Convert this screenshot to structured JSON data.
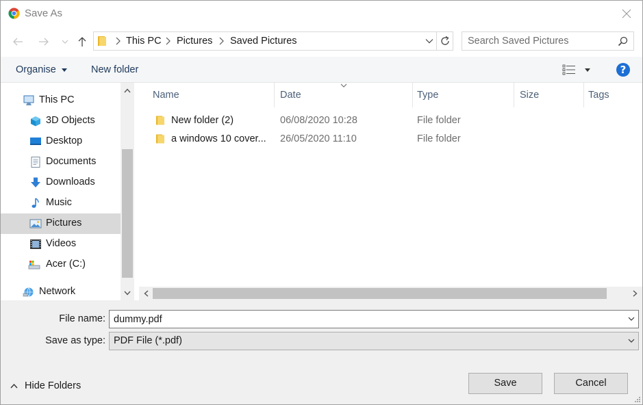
{
  "window": {
    "title": "Save As",
    "close": "×"
  },
  "address_bar": {
    "crumbs": [
      "This PC",
      "Pictures",
      "Saved Pictures"
    ]
  },
  "search": {
    "placeholder": "Search Saved Pictures"
  },
  "toolbar": {
    "organise": "Organise",
    "new_folder": "New folder",
    "help": "?"
  },
  "nav_pane": {
    "items": [
      {
        "label": "This PC",
        "icon": "computer-icon",
        "selected": false
      },
      {
        "label": "3D Objects",
        "icon": "cube-icon",
        "selected": false
      },
      {
        "label": "Desktop",
        "icon": "desktop-icon",
        "selected": false
      },
      {
        "label": "Documents",
        "icon": "documents-icon",
        "selected": false
      },
      {
        "label": "Downloads",
        "icon": "download-icon",
        "selected": false
      },
      {
        "label": "Music",
        "icon": "music-note-icon",
        "selected": false
      },
      {
        "label": "Pictures",
        "icon": "pictures-icon",
        "selected": true
      },
      {
        "label": "Videos",
        "icon": "film-icon",
        "selected": false
      },
      {
        "label": "Acer (C:)",
        "icon": "drive-icon",
        "selected": false
      },
      {
        "label": "Network",
        "icon": "network-icon",
        "selected": false
      }
    ]
  },
  "file_list": {
    "columns": [
      "Name",
      "Date",
      "Type",
      "Size",
      "Tags"
    ],
    "rows": [
      {
        "name": "New folder (2)",
        "date": "06/08/2020 10:28",
        "type": "File folder",
        "size": ""
      },
      {
        "name": "a windows 10 cover...",
        "date": "26/05/2020 11:10",
        "type": "File folder",
        "size": ""
      }
    ]
  },
  "form": {
    "file_name_label": "File name:",
    "file_name_value": "dummy.pdf",
    "save_as_type_label": "Save as type:",
    "save_as_type_value": "PDF File (*.pdf)"
  },
  "footer": {
    "hide_folders": "Hide Folders",
    "save": "Save",
    "cancel": "Cancel"
  },
  "colors": {
    "accent": "#1c6fd4",
    "selected_bg": "#d9d9d9",
    "folder": "#f4c542"
  }
}
